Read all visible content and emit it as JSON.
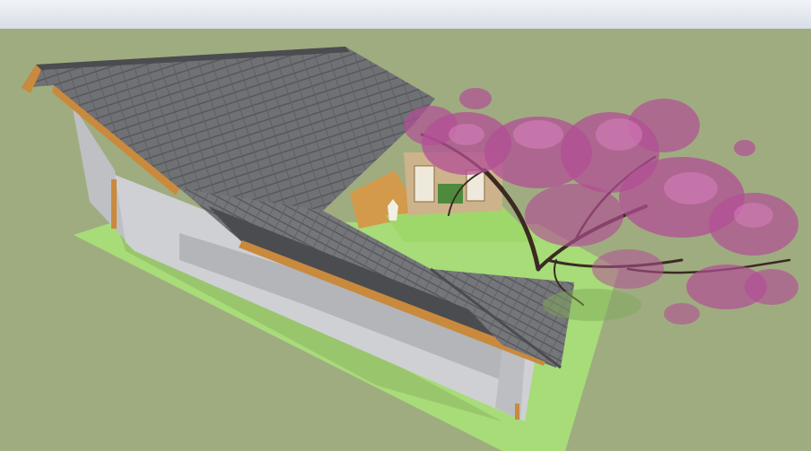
{
  "scene": {
    "colors": {
      "sky": "#dfe6ee",
      "ground": "#9fac80",
      "lawn": "#a7dc79",
      "wall": "#cfd0d3",
      "wall_shadow": "#a9abb0",
      "roof": "#6e6f73",
      "roof_dark": "#4b4c50",
      "timber": "#c98a3e",
      "deck": "#d39a4c",
      "blossom": "#b24f95",
      "branch": "#3b2a22"
    }
  }
}
